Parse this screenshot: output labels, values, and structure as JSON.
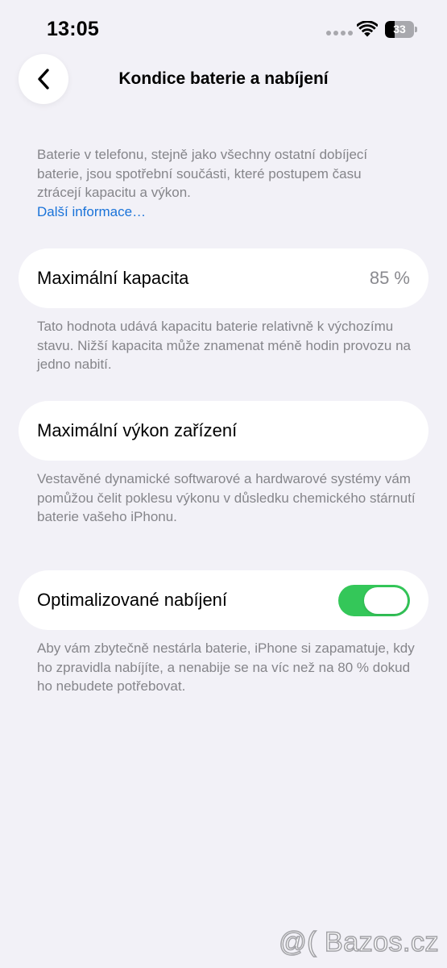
{
  "status_bar": {
    "time": "13:05",
    "battery_level": "33",
    "battery_fraction": 0.33,
    "icons": [
      "cellular-dots-icon",
      "wifi-icon",
      "battery-icon"
    ]
  },
  "nav": {
    "back_icon": "chevron-left-icon",
    "title": "Kondice baterie a nabíjení"
  },
  "intro": {
    "text": "Baterie v telefonu, stejně jako všechny ostatní dobíjecí baterie, jsou spotřební součásti, které postupem času ztrácejí kapacitu a výkon.",
    "link": "Další informace…"
  },
  "max_capacity": {
    "label": "Maximální kapacita",
    "value": "85 %",
    "note": "Tato hodnota udává kapacitu baterie relativně k výchozímu stavu. Nižší kapacita může znamenat méně hodin provozu na jedno nabití."
  },
  "peak_performance": {
    "label": "Maximální výkon zařízení",
    "note": "Vestavěné dynamické softwarové a hardwarové systémy vám pomůžou čelit poklesu výkonu v důsledku chemického stárnutí baterie vašeho iPhonu."
  },
  "optimized_charging": {
    "label": "Optimalizované nabíjení",
    "enabled": true,
    "note": "Aby vám zbytečně nestárla baterie, iPhone si zapamatuje, kdy ho zpravidla nabíjíte, a nenabije se na víc než na 80 % dokud ho nebudete potřebovat."
  },
  "colors": {
    "background": "#f2f1f7",
    "link": "#1a73d9",
    "toggle_on": "#34c759",
    "secondary_text": "#85858a"
  },
  "watermark": "@( Bazos.cz"
}
